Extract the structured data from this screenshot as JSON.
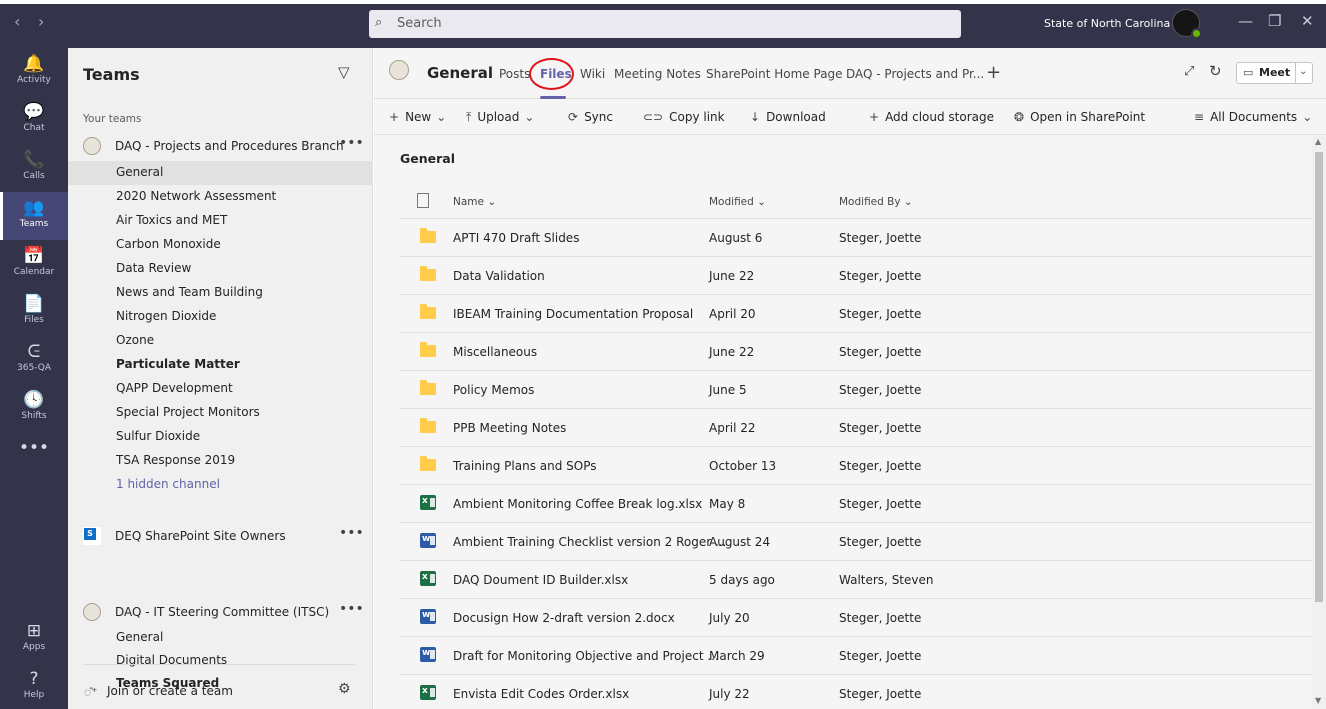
{
  "window": {
    "top_text": "...p...",
    "search_placeholder": "Search",
    "org": "State of North Carolina ⌄",
    "nav_back": "‹",
    "nav_forward": "›",
    "minimize": "—",
    "restore": "❐",
    "close": "✕",
    "colors": {
      "frame": "#33344a",
      "accent": "#6264a7",
      "highlight": "#e0151b"
    }
  },
  "rail": {
    "items": [
      {
        "label": "Activity",
        "icon": "bell-icon",
        "glyph": "🔔"
      },
      {
        "label": "Chat",
        "icon": "chat-icon",
        "glyph": "💬"
      },
      {
        "label": "Calls",
        "icon": "phone-icon",
        "glyph": "📞"
      },
      {
        "label": "Teams",
        "icon": "teams-icon",
        "glyph": "👥"
      },
      {
        "label": "Calendar",
        "icon": "calendar-icon",
        "glyph": "📅"
      },
      {
        "label": "Files",
        "icon": "files-icon",
        "glyph": "📄"
      },
      {
        "label": "365-QA",
        "icon": "qa-app-icon",
        "glyph": "ᕮ"
      },
      {
        "label": "Shifts",
        "icon": "shifts-icon",
        "glyph": "🕓"
      },
      {
        "label": "",
        "icon": "more-apps-icon",
        "glyph": "•••"
      },
      {
        "label": "Apps",
        "icon": "apps-icon",
        "glyph": "⊞"
      },
      {
        "label": "Help",
        "icon": "help-icon",
        "glyph": "?"
      }
    ]
  },
  "teams_panel": {
    "title": "Teams",
    "your_teams": "Your teams",
    "more": "•••",
    "teams": [
      {
        "name": "DAQ - Projects and Procedures Branch",
        "channels": [
          "General",
          "2020 Network Assessment",
          "Air Toxics and MET",
          "Carbon Monoxide",
          "Data Review",
          "News and Team Building",
          "Nitrogen Dioxide",
          "Ozone",
          "Particulate Matter",
          "QAPP Development",
          "Special Project Monitors",
          "Sulfur Dioxide",
          "TSA Response 2019",
          "1 hidden channel"
        ]
      },
      {
        "name": "DEQ SharePoint Site Owners",
        "logo_text": "S",
        "channels": []
      },
      {
        "name": "DAQ - IT Steering Committee (ITSC)",
        "channels": [
          "General",
          "Digital Documents",
          "Teams Squared"
        ]
      }
    ],
    "join": "Join or create a team"
  },
  "header": {
    "channel": "General",
    "tabs": [
      "Posts",
      "Files",
      "Wiki",
      "Meeting Notes",
      "SharePoint Home Page",
      "DAQ - Projects and Pr..."
    ],
    "active_tab": "Files",
    "add_tab": "+",
    "meet": "Meet"
  },
  "commands": {
    "new": "New",
    "upload": "Upload",
    "sync": "Sync",
    "copy_link": "Copy link",
    "download": "Download",
    "add_cloud": "Add cloud storage",
    "open_sp": "Open in SharePoint",
    "all_docs": "All Documents"
  },
  "library": {
    "title": "General",
    "columns": {
      "name": "Name ⌄",
      "modified": "Modified ⌄",
      "modified_by": "Modified By ⌄"
    },
    "rows": [
      {
        "type": "folder",
        "name": "APTI 470 Draft Slides",
        "modified": "August 6",
        "by": "Steger, Joette"
      },
      {
        "type": "folder",
        "name": "Data Validation",
        "modified": "June 22",
        "by": "Steger, Joette"
      },
      {
        "type": "folder",
        "name": "IBEAM Training Documentation Proposal",
        "modified": "April 20",
        "by": "Steger, Joette"
      },
      {
        "type": "folder",
        "name": "Miscellaneous",
        "modified": "June 22",
        "by": "Steger, Joette"
      },
      {
        "type": "folder",
        "name": "Policy Memos",
        "modified": "June 5",
        "by": "Steger, Joette"
      },
      {
        "type": "folder",
        "name": "PPB Meeting Notes",
        "modified": "April 22",
        "by": "Steger, Joette"
      },
      {
        "type": "folder",
        "name": "Training Plans and SOPs",
        "modified": "October 13",
        "by": "Steger, Joette"
      },
      {
        "type": "excel",
        "name": "Ambient Monitoring Coffee Break log.xlsx",
        "modified": "May 8",
        "by": "Steger, Joette"
      },
      {
        "type": "word",
        "name": "Ambient Training Checklist version 2 Roger ...",
        "modified": "August 24",
        "by": "Steger, Joette"
      },
      {
        "type": "excel",
        "name": "DAQ Doument ID Builder.xlsx",
        "modified": "5 days ago",
        "by": "Walters, Steven"
      },
      {
        "type": "word",
        "name": "Docusign How 2-draft version 2.docx",
        "modified": "July 20",
        "by": "Steger, Joette"
      },
      {
        "type": "word",
        "name": "Draft for Monitoring Objective and Project ...",
        "modified": "March 29",
        "by": "Steger, Joette"
      },
      {
        "type": "excel",
        "name": "Envista Edit Codes Order.xlsx",
        "modified": "July 22",
        "by": "Steger, Joette"
      }
    ]
  }
}
